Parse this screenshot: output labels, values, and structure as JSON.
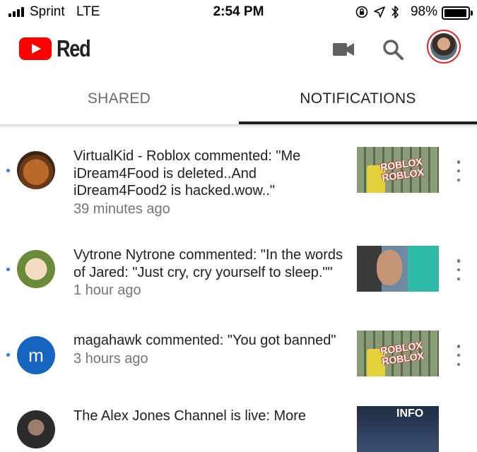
{
  "status_bar": {
    "carrier": "Sprint",
    "network": "LTE",
    "time": "2:54 PM",
    "battery_percent": "98%",
    "battery_level": 0.98,
    "icons": [
      "signal-bars-icon",
      "orientation-lock-icon",
      "location-arrow-icon",
      "bluetooth-icon",
      "battery-icon"
    ]
  },
  "header": {
    "brand": "Red",
    "icons": [
      "youtube-play-logo",
      "video-camera-icon",
      "search-icon",
      "account-avatar"
    ],
    "accent_color": "#ff0000"
  },
  "tabs": {
    "shared": "SHARED",
    "notifications": "NOTIFICATIONS",
    "active": "notifications"
  },
  "notifications": [
    {
      "message": "VirtualKid - Roblox commented: \"Me iDream4Food is deleted..And iDream4Food2 is hacked.wow..\"",
      "time": "39 minutes ago",
      "unread": true,
      "avatar": "pumpkin-avatar",
      "thumbnail": "roblox-video-thumbnail",
      "thumbnail_text": "ROBLOX ROBLOX"
    },
    {
      "message": "Vytrone Nytrone commented: \"In the words of Jared: \"Just cry, cry yourself to sleep.\"\"",
      "time": "1 hour ago",
      "unread": true,
      "avatar": "cartoon-avatar",
      "thumbnail": "face-video-thumbnail"
    },
    {
      "message": "magahawk commented: \"You got banned\"",
      "time": "3 hours ago",
      "unread": true,
      "avatar": "letter-avatar",
      "avatar_letter": "m",
      "thumbnail": "roblox-video-thumbnail",
      "thumbnail_text": "ROBLOX ROBLOX"
    },
    {
      "message": "The Alex Jones Channel is live: More",
      "time": "",
      "unread": false,
      "avatar": "person-avatar",
      "thumbnail": "news-video-thumbnail",
      "thumbnail_text": "INFO"
    }
  ]
}
